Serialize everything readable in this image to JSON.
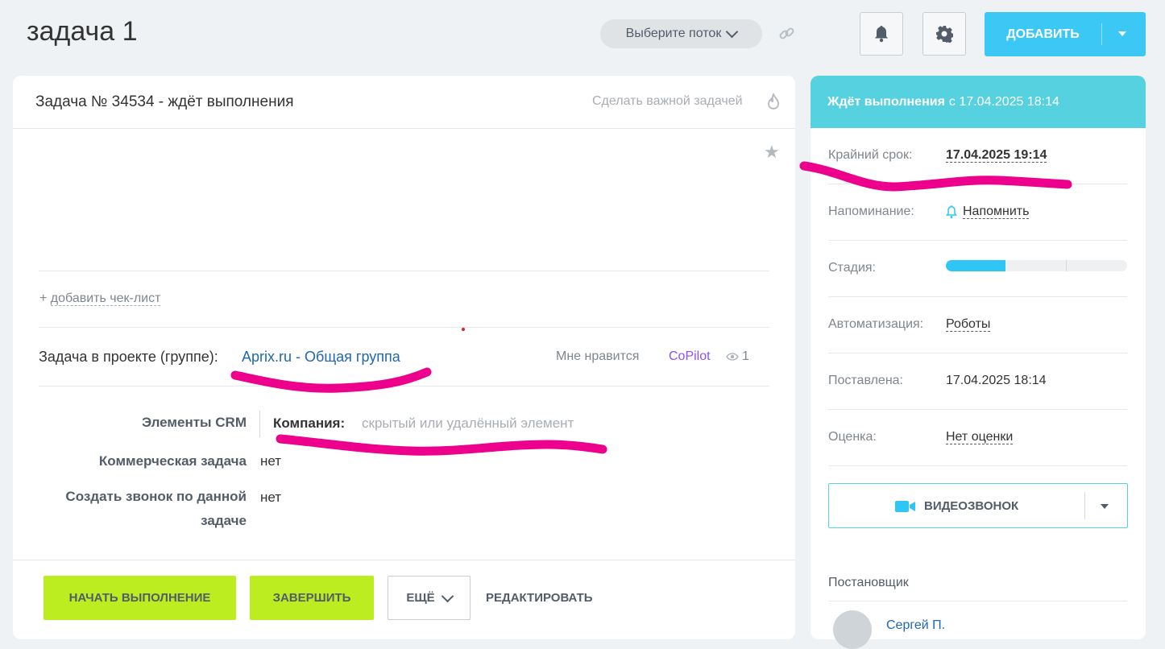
{
  "header": {
    "title": "задача 1",
    "flow_select": "Выберите поток",
    "add_button": "ДОБАВИТЬ"
  },
  "task": {
    "heading": "Задача № 34534 - ждёт выполнения",
    "make_important": "Сделать важной задачей",
    "add_checklist_plus": "+",
    "add_checklist": "добавить чек-лист",
    "project_label": "Задача в проекте (группе):",
    "project_link": "Aprix.ru - Общая группа",
    "like": "Мне нравится",
    "copilot": "CoPilot",
    "views": "1",
    "fields": {
      "crm_label": "Элементы CRM",
      "crm_company_label": "Компания:",
      "crm_company_value": "скрытый или удалённый элемент",
      "commercial_label": "Коммерческая задача",
      "commercial_value": "нет",
      "call_label_line1": "Создать звонок по данной",
      "call_label_line2": "задаче",
      "call_value": "нет"
    },
    "buttons": {
      "start": "НАЧАТЬ ВЫПОЛНЕНИЕ",
      "finish": "ЗАВЕРШИТЬ",
      "more": "ЕЩЁ",
      "edit": "РЕДАКТИРОВАТЬ"
    }
  },
  "sidebar": {
    "status": "Ждёт выполнения",
    "status_since": "с 17.04.2025 18:14",
    "deadline_label": "Крайний срок:",
    "deadline_value": "17.04.2025 19:14",
    "reminder_label": "Напоминание:",
    "reminder_value": "Напомнить",
    "stage_label": "Стадия:",
    "stage_progress": 0.33,
    "automation_label": "Автоматизация:",
    "automation_value": "Роботы",
    "created_label": "Поставлена:",
    "created_value": "17.04.2025 18:14",
    "rating_label": "Оценка:",
    "rating_value": "Нет оценки",
    "video_button": "ВИДЕОЗВОНОК",
    "creator_label": "Постановщик",
    "creator_name": "Сергей П."
  },
  "colors": {
    "accent": "#3bc8f5",
    "status_bar": "#56d1e0",
    "green_button": "#bbed21",
    "marker": "#ec008c",
    "link": "#2067b0"
  }
}
